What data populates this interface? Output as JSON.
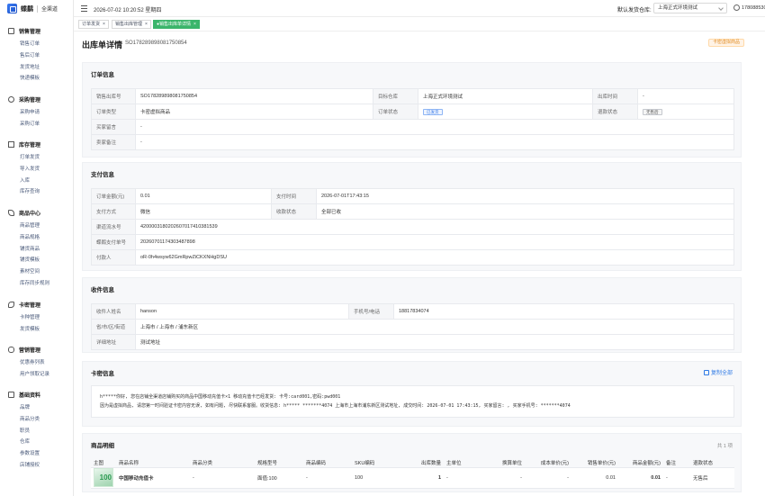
{
  "app": {
    "name": "蝶鹬",
    "subtitle": "全渠道"
  },
  "header": {
    "datetime": "2026-07-02 10:20:52 星期四",
    "warehouse_label": "默认发货仓库:",
    "warehouse_value": "上海正式环境测试",
    "phone": "17808853001"
  },
  "sidebar": {
    "groups": [
      {
        "label": "销售管理",
        "items": [
          "销售订单",
          "售后订单",
          "发货地址",
          "快递模板"
        ]
      },
      {
        "label": "采购管理",
        "items": [
          "采购申请",
          "采购订单"
        ]
      },
      {
        "label": "库存管理",
        "items": [
          "打单发货",
          "导入发货",
          "入库",
          "库存查询"
        ]
      },
      {
        "label": "商品中心",
        "items": [
          "商品管理",
          "商品规格",
          "铺货商品",
          "铺货模板",
          "素材空间",
          "库存同步规则"
        ]
      },
      {
        "label": "卡密管理",
        "items": [
          "卡种管理",
          "发货模板"
        ]
      },
      {
        "label": "营销管理",
        "items": [
          "优惠券列表",
          "用户领取记录"
        ]
      },
      {
        "label": "基础资料",
        "items": [
          "品牌",
          "商品分类",
          "职员",
          "仓库",
          "参数设置",
          "店铺授权"
        ]
      }
    ]
  },
  "tabs": [
    {
      "label": "订单发货"
    },
    {
      "label": "销售出库管理"
    },
    {
      "label": "●销售出库单详情"
    }
  ],
  "page": {
    "title": "出库单详情",
    "order_no": "SO178289898081750854",
    "status": "卡密虚拟商品"
  },
  "order_info": {
    "title": "订单信息",
    "rows": [
      [
        "销售出库号",
        "SO178289898081750854",
        "目标仓库",
        "上海正式环境测试",
        "出库时间",
        "-"
      ],
      [
        "订单类型",
        "卡密虚拟商品",
        "订单状态",
        "已发货",
        "退款状态",
        "无售后"
      ],
      [
        "买家留言",
        "-"
      ],
      [
        "卖家备注",
        "-"
      ]
    ]
  },
  "payment_info": {
    "title": "支付信息",
    "rows": [
      [
        "订单金额(元)",
        "0.01",
        "支付时间",
        "2026-07-01T17:43:15"
      ],
      [
        "支付方式",
        "微信",
        "收款状态",
        "全部已收"
      ],
      [
        "渠道流水号",
        "4200003180202607017410381539"
      ],
      [
        "蝶鹬支付单号",
        "20260701174303487898"
      ],
      [
        "付款人",
        "oR-0h4wsyw62GmRpwZiCKXNHgDSU"
      ]
    ]
  },
  "receiver_info": {
    "title": "收件信息",
    "rows": [
      [
        "收件人姓名",
        "hanson",
        "手机号/电话",
        "18817834074"
      ],
      [
        "省/市/区/街道",
        "上海市 / 上海市 / 浦东新区"
      ],
      [
        "详细地址",
        "测试地址"
      ]
    ]
  },
  "card_info": {
    "title": "卡密信息",
    "copy_label": "复制全部",
    "line1": "h*****你好, 您在店铺全渠道店铺购买的商品中国移动充值卡×1  移动充值卡已经发货: 卡号:card001,密码:pwd001",
    "line2": "因为是虚拟商品, 请您第一时间验证卡密内容无误, 如有问题, 尽快联系客服。收货信息: h***** *******4074 上海市上海市浦东新区测试地址, 成交时间: 2026-07-01 17:43:15, 买家留言: , 买家手机号: *******4074"
  },
  "goods": {
    "title": "商品明细",
    "count": "共 1 项",
    "columns": [
      "主图",
      "商品名称",
      "商品分类",
      "规格型号",
      "商品编码",
      "SKU编码",
      "出库数量",
      "主单位",
      "换算单位",
      "成本单价(元)",
      "销售单价(元)",
      "商品金额(元)",
      "备注",
      "退款状态"
    ],
    "rows": [
      {
        "thumb": "100",
        "name": "中国移动充值卡",
        "category": "-",
        "spec": "面值:100",
        "code": "-",
        "sku": "100",
        "qty": "1",
        "unit": "-",
        "conv": "-",
        "cost": "-",
        "price": "0.01",
        "amount": "0.01",
        "remark": "-",
        "refund": "无售后"
      }
    ]
  },
  "colors": {
    "accent": "#2f7ae5",
    "tab_active": "#3bb56b",
    "amount": "#e69a1a"
  }
}
